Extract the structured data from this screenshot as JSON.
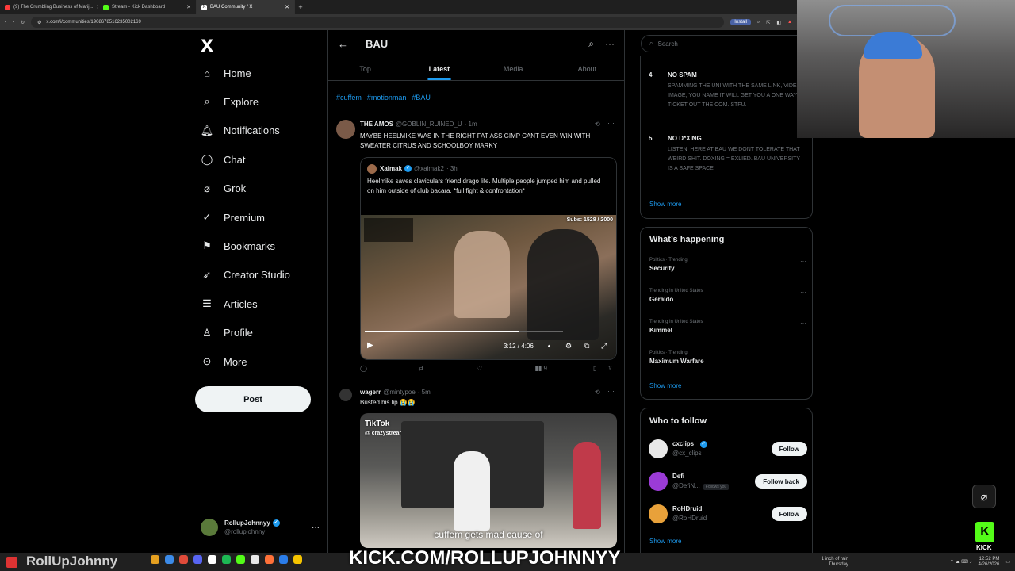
{
  "browser": {
    "tabs": [
      {
        "title": "(9) The Crumbling Business of Marij...",
        "color": "#ff3b3b",
        "active": false
      },
      {
        "title": "Stream - Kick Dashboard",
        "color": "#53fc18",
        "active": false
      },
      {
        "title": "BAU Community / X",
        "color": "#ffffff",
        "active": true
      }
    ],
    "url": "x.com/i/communities/1908678516235002169",
    "install_label": "Install"
  },
  "nav": {
    "logo": "X",
    "items": [
      {
        "label": "Home",
        "icon": "home-icon"
      },
      {
        "label": "Explore",
        "icon": "search-icon"
      },
      {
        "label": "Notifications",
        "icon": "bell-icon"
      },
      {
        "label": "Chat",
        "icon": "chat-icon"
      },
      {
        "label": "Grok",
        "icon": "grok-icon"
      },
      {
        "label": "Premium",
        "icon": "premium-icon"
      },
      {
        "label": "Bookmarks",
        "icon": "bookmark-icon"
      },
      {
        "label": "Creator Studio",
        "icon": "rocket-icon"
      },
      {
        "label": "Articles",
        "icon": "article-icon"
      },
      {
        "label": "Profile",
        "icon": "person-icon"
      },
      {
        "label": "More",
        "icon": "more-circle-icon"
      }
    ],
    "post_label": "Post",
    "account": {
      "name": "RollupJohnnyy",
      "handle": "@rollupjohnny"
    }
  },
  "community": {
    "title": "BAU",
    "tabs": [
      "Top",
      "Latest",
      "Media",
      "About"
    ],
    "selected_tab": "Latest",
    "hashtags": [
      "#cuffem",
      "#motionman",
      "#BAU"
    ]
  },
  "posts": [
    {
      "name": "THE AMOS",
      "handle": "@GOBLIN_RUINED_U",
      "time": "· 1m",
      "text": "MAYBE HEELMIKE WAS IN THE RIGHT FAT ASS GIMP CANT EVEN WIN WITH SWEATER CITRUS AND SCHOOLBOY MARKY",
      "quote": {
        "name": "Xaimak",
        "handle": "@xaimak2",
        "time": "· 3h",
        "text": "Heelmike saves claviculars friend drago life. Multiple people jumped him and pulled on him outside of club bacara. *full fight & confrontation*",
        "video_overlay": "Subs: 1528 / 2000",
        "video_time": "3:12 / 4:06",
        "progress": 0.78
      },
      "views": "9"
    },
    {
      "name": "wagerr",
      "handle": "@mintypoe",
      "time": "· 5m",
      "text": "Busted his lip 😭😭",
      "video_brand": "TikTok",
      "video_handle": "@ crazystreamhighlightz",
      "video_caption": "cuffem gets mad cause of"
    }
  ],
  "sidebar": {
    "search_placeholder": "Search",
    "rules": [
      {
        "num": "4",
        "title": "NO SPAM",
        "desc": "SPAMMING THE UNI WITH THE SAME LINK, VIDEO, IMAGE, YOU NAME IT WILL GET YOU A ONE WAY TICKET OUT THE COM. STFU."
      },
      {
        "num": "5",
        "title": "NO D*XING",
        "desc": "LISTEN. HERE AT BAU WE DONT TOLERATE THAT WEIRD SHIT. DOXING = EXLIED. BAU UNIVERSITY IS A SAFE SPACE"
      }
    ],
    "show_more": "Show more",
    "happening_title": "What’s happening",
    "trends": [
      {
        "category": "Politics · Trending",
        "name": "Security"
      },
      {
        "category": "Trending in United States",
        "name": "Geraldo"
      },
      {
        "category": "Trending in United States",
        "name": "Kimmel"
      },
      {
        "category": "Politics · Trending",
        "name": "Maximum Warfare"
      }
    ],
    "who_title": "Who to follow",
    "who": [
      {
        "name": "cxclips_",
        "handle": "@cx_clips",
        "button": "Follow",
        "follows_you": "",
        "color": "#e8e8e8"
      },
      {
        "name": "Defi",
        "handle": "@DefiN...",
        "button": "Follow back",
        "follows_you": "Follows you",
        "color": "#9b3bd6"
      },
      {
        "name": "RoHDruid",
        "handle": "@RoHDruid",
        "button": "Follow",
        "follows_you": "",
        "color": "#e8a13a"
      }
    ]
  },
  "overlay": {
    "streamer_name": "RollUpJohnny",
    "kick_url": "KICK.COM/ROLLUPJOHNNYY",
    "kick_label": "KICK",
    "weather": "1 inch of rain",
    "weather_day": "Thursday",
    "clock": "12:52 PM",
    "date": "4/26/2026"
  }
}
